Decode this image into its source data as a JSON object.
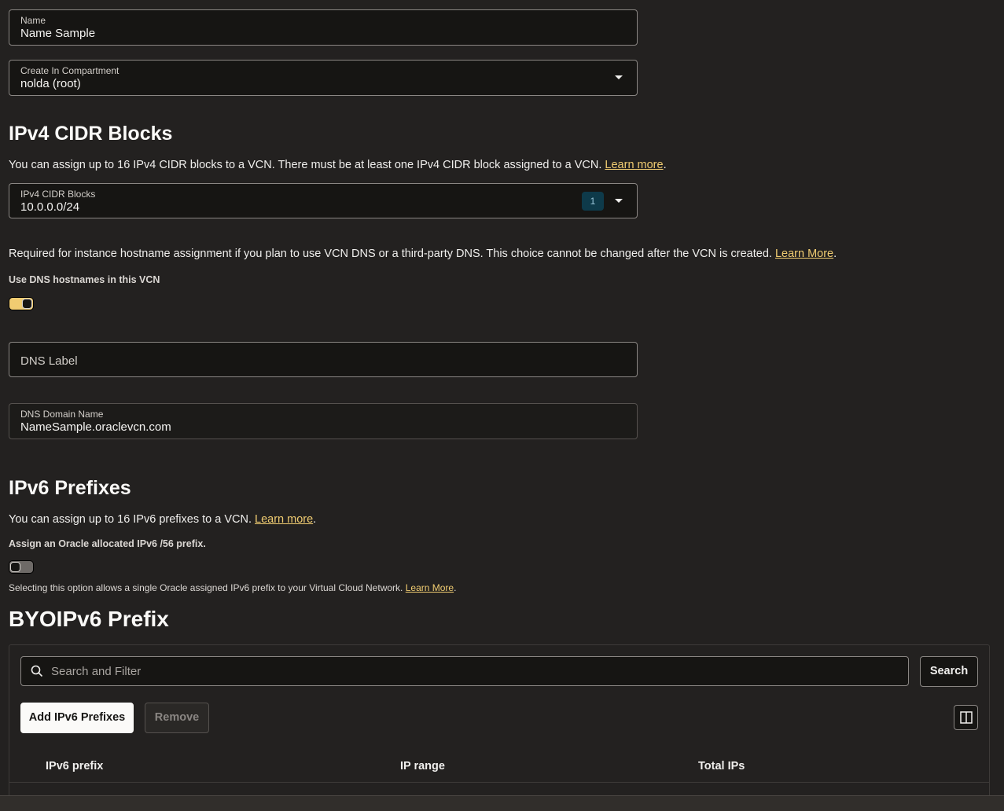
{
  "name_field": {
    "label": "Name",
    "value": "Name Sample"
  },
  "compartment_field": {
    "label": "Create In Compartment",
    "value": "nolda (root)"
  },
  "ipv4": {
    "heading": "IPv4 CIDR Blocks",
    "description": "You can assign up to 16 IPv4 CIDR blocks to a VCN. There must be at least one IPv4 CIDR block assigned to a VCN.",
    "learn_more": "Learn more",
    "field_label": "IPv4 CIDR Blocks",
    "field_value": "10.0.0.0/24",
    "count_badge": "1"
  },
  "dns": {
    "description": "Required for instance hostname assignment if you plan to use VCN DNS or a third-party DNS. This choice cannot be changed after the VCN is created.",
    "learn_more": "Learn More",
    "toggle_label": "Use DNS hostnames in this VCN",
    "toggle_on": true,
    "label_placeholder": "DNS Label",
    "domain_label": "DNS Domain Name",
    "domain_value": "NameSample.oraclevcn.com"
  },
  "ipv6": {
    "heading": "IPv6 Prefixes",
    "description": "You can assign up to 16 IPv6 prefixes to a VCN.",
    "learn_more": "Learn more",
    "toggle_label": "Assign an Oracle allocated IPv6 /56 prefix.",
    "toggle_on": false,
    "help": "Selecting this option allows a single Oracle assigned IPv6 prefix to your Virtual Cloud Network.",
    "help_link": "Learn More"
  },
  "byoip": {
    "heading": "BYOIPv6 Prefix",
    "search_placeholder": "Search and Filter",
    "search_button": "Search",
    "add_button": "Add IPv6 Prefixes",
    "remove_button": "Remove",
    "columns": [
      "IPv6 prefix",
      "IP range",
      "Total IPs"
    ]
  },
  "colors": {
    "accent": "#f0cc71",
    "background": "#232120",
    "field_bg": "#161513"
  },
  "icons": {
    "dropdown": "chevron-down-icon",
    "search": "search-icon",
    "columns": "columns-icon"
  }
}
